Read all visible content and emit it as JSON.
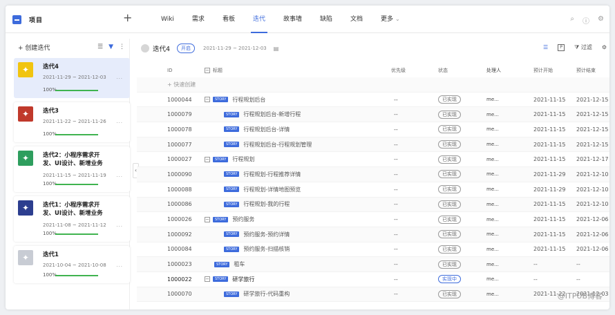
{
  "topbar": {
    "project_name": "项目",
    "nav": [
      "Wiki",
      "需求",
      "看板",
      "迭代",
      "故事墙",
      "缺陷",
      "文档",
      "更多"
    ],
    "active_index": 3,
    "icons": [
      "search-icon",
      "help-icon",
      "settings-icon"
    ]
  },
  "sidebar": {
    "create_label": "+ 创建迭代",
    "cards": [
      {
        "title": "迭代4",
        "date": "2021-11-29 ~ 2021-12-03",
        "owner": "...",
        "pct_label": "100%",
        "pct": 1.0,
        "color": "#f1c40f",
        "selected": true
      },
      {
        "title": "迭代3",
        "date": "2021-11-22 ~ 2021-11-26",
        "owner": "...",
        "pct_label": "100%",
        "pct": 1.0,
        "color": "#c0392b",
        "selected": false
      },
      {
        "title": "迭代2：小程序需求开发、UI设计、新增业务",
        "date": "2021-11-15 ~ 2021-11-19",
        "owner": "...",
        "pct_label": "100%",
        "pct": 1.0,
        "color": "#2e9e5e",
        "selected": false
      },
      {
        "title": "迭代1：小程序需求开发、UI设计、新增业务",
        "date": "2021-11-08 ~ 2021-11-12",
        "owner": "...",
        "pct_label": "100%",
        "pct": 1.0,
        "color": "#2c3e8f",
        "selected": false
      },
      {
        "title": "迭代1",
        "date": "2021-10-04 ~ 2021-10-08",
        "owner": "...",
        "pct_label": "100%",
        "pct": 1.0,
        "color": "#c8ccd4",
        "selected": false
      }
    ]
  },
  "main": {
    "iter_name": "迭代4",
    "status": "开启",
    "dates": "2021-11-29 ~ 2021-12-03",
    "filter_label": "过滤",
    "columns": {
      "id": "ID",
      "title": "标题",
      "priority": "优先级",
      "state": "状态",
      "owner": "处理人",
      "start": "预计开始",
      "end": "预计结束"
    },
    "quick_create": "+ 快速创建",
    "rows": [
      {
        "id": "1000044",
        "title": "行程规划后台",
        "level": 0,
        "expand": true,
        "priority": "--",
        "state": "已实现",
        "owner": "me...",
        "start": "2021-11-15",
        "end": "2021-12-15"
      },
      {
        "id": "1000079",
        "title": "行程规划后台-新增行程",
        "level": 1,
        "expand": false,
        "priority": "--",
        "state": "已实现",
        "owner": "me...",
        "start": "2021-11-15",
        "end": "2021-12-15"
      },
      {
        "id": "1000078",
        "title": "行程规划后台-详情",
        "level": 1,
        "expand": false,
        "priority": "--",
        "state": "已实现",
        "owner": "me...",
        "start": "2021-11-15",
        "end": "2021-12-15"
      },
      {
        "id": "1000077",
        "title": "行程规划后台-行程规划管理",
        "level": 1,
        "expand": false,
        "priority": "--",
        "state": "已实现",
        "owner": "me...",
        "start": "2021-11-15",
        "end": "2021-12-15"
      },
      {
        "id": "1000027",
        "title": "行程规划",
        "level": 0,
        "expand": true,
        "priority": "--",
        "state": "已实现",
        "owner": "me...",
        "start": "2021-11-15",
        "end": "2021-12-17"
      },
      {
        "id": "1000090",
        "title": "行程规划-行程推荐详情",
        "level": 1,
        "expand": false,
        "priority": "--",
        "state": "已实现",
        "owner": "me...",
        "start": "2021-11-29",
        "end": "2021-12-10"
      },
      {
        "id": "1000088",
        "title": "行程规划-详情地图预览",
        "level": 1,
        "expand": false,
        "priority": "--",
        "state": "已实现",
        "owner": "me...",
        "start": "2021-11-29",
        "end": "2021-12-10"
      },
      {
        "id": "1000086",
        "title": "行程规划-我的行程",
        "level": 1,
        "expand": false,
        "priority": "--",
        "state": "已实现",
        "owner": "me...",
        "start": "2021-11-15",
        "end": "2021-12-10"
      },
      {
        "id": "1000026",
        "title": "预约服务",
        "level": 0,
        "expand": true,
        "priority": "--",
        "state": "已实现",
        "owner": "me...",
        "start": "2021-11-15",
        "end": "2021-12-06"
      },
      {
        "id": "1000092",
        "title": "预约服务-预约详情",
        "level": 1,
        "expand": false,
        "priority": "--",
        "state": "已实现",
        "owner": "me...",
        "start": "2021-11-15",
        "end": "2021-12-06"
      },
      {
        "id": "1000084",
        "title": "预约服务-扫描核销",
        "level": 1,
        "expand": false,
        "priority": "--",
        "state": "已实现",
        "owner": "me...",
        "start": "2021-11-15",
        "end": "2021-12-06"
      },
      {
        "id": "1000023",
        "title": "租车",
        "level": 2,
        "expand": false,
        "priority": "--",
        "state": "已实现",
        "owner": "me...",
        "start": "--",
        "end": "--"
      },
      {
        "id": "1000022",
        "title": "研学旅行",
        "level": 0,
        "expand": true,
        "priority": "--",
        "state": "实现中",
        "owner": "me...",
        "start": "--",
        "end": "--",
        "bold": true
      },
      {
        "id": "1000070",
        "title": "研学旅行-代码重构",
        "level": 1,
        "expand": false,
        "priority": "--",
        "state": "已实现",
        "owner": "me...",
        "start": "2021-11-22",
        "end": "2021-12-03"
      }
    ]
  },
  "watermark": "@ITPUB博客"
}
